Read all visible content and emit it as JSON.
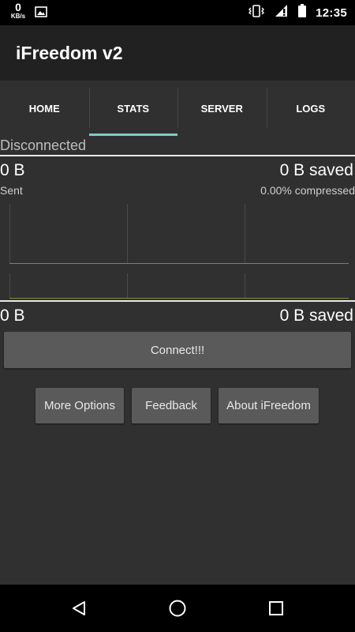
{
  "status_bar": {
    "net_speed_value": "0",
    "net_speed_unit": "KB/s",
    "time": "12:35",
    "icons": [
      "image-icon",
      "vibrate-icon",
      "signal-icon",
      "battery-icon"
    ]
  },
  "app_bar": {
    "title": "iFreedom v2"
  },
  "tabs": [
    {
      "label": "HOME",
      "active": false
    },
    {
      "label": "STATS",
      "active": true
    },
    {
      "label": "SERVER",
      "active": false
    },
    {
      "label": "LOGS",
      "active": false
    }
  ],
  "stats": {
    "connection_status": "Disconnected",
    "sent": {
      "amount": "0 B",
      "saved": "0 B saved",
      "label": "Sent",
      "compression": "0.00% compressed"
    },
    "received": {
      "amount": "0 B",
      "saved": "0 B saved"
    }
  },
  "buttons": {
    "connect": "Connect!!!",
    "more_options": "More Options",
    "feedback": "Feedback",
    "about": "About iFreedom"
  },
  "nav_bar": {
    "icons": [
      "back-icon",
      "home-icon",
      "recents-icon"
    ]
  },
  "colors": {
    "accent": "#80cbc4",
    "graph_baseline": "#7d8b3a",
    "background": "#303030",
    "app_bar": "#212121"
  }
}
